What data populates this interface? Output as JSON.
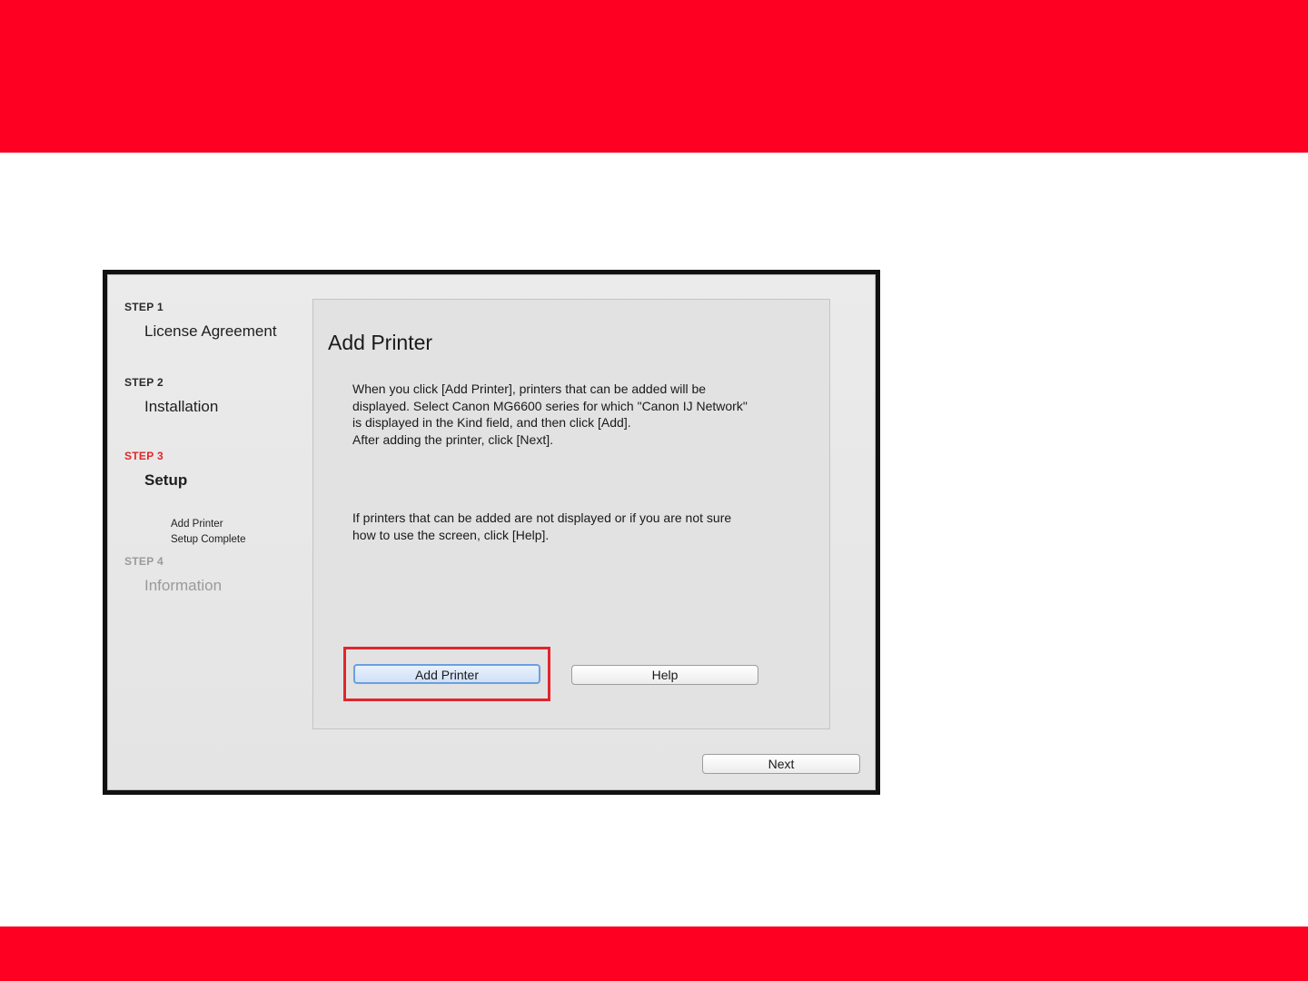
{
  "colors": {
    "brand_red": "#fd0022",
    "active_step": "#e2262b",
    "highlight": "#e0262b"
  },
  "sidebar": {
    "steps": [
      {
        "label": "STEP 1",
        "title": "License Agreement"
      },
      {
        "label": "STEP 2",
        "title": "Installation"
      },
      {
        "label": "STEP 3",
        "title": "Setup",
        "sub_items": [
          "Add Printer",
          "Setup Complete"
        ]
      },
      {
        "label": "STEP 4",
        "title": "Information"
      }
    ]
  },
  "main": {
    "title": "Add Printer",
    "paragraph1": "When you click [Add Printer], printers that can be added will be\ndisplayed. Select Canon MG6600 series for which \"Canon IJ Network\"\nis displayed in the Kind field, and then click [Add].\nAfter adding the printer, click [Next].",
    "paragraph2": "If printers that can be added are not displayed or if you are not sure\nhow to use the screen, click [Help].",
    "add_printer_label": "Add Printer",
    "help_label": "Help"
  },
  "footer": {
    "next_label": "Next"
  }
}
